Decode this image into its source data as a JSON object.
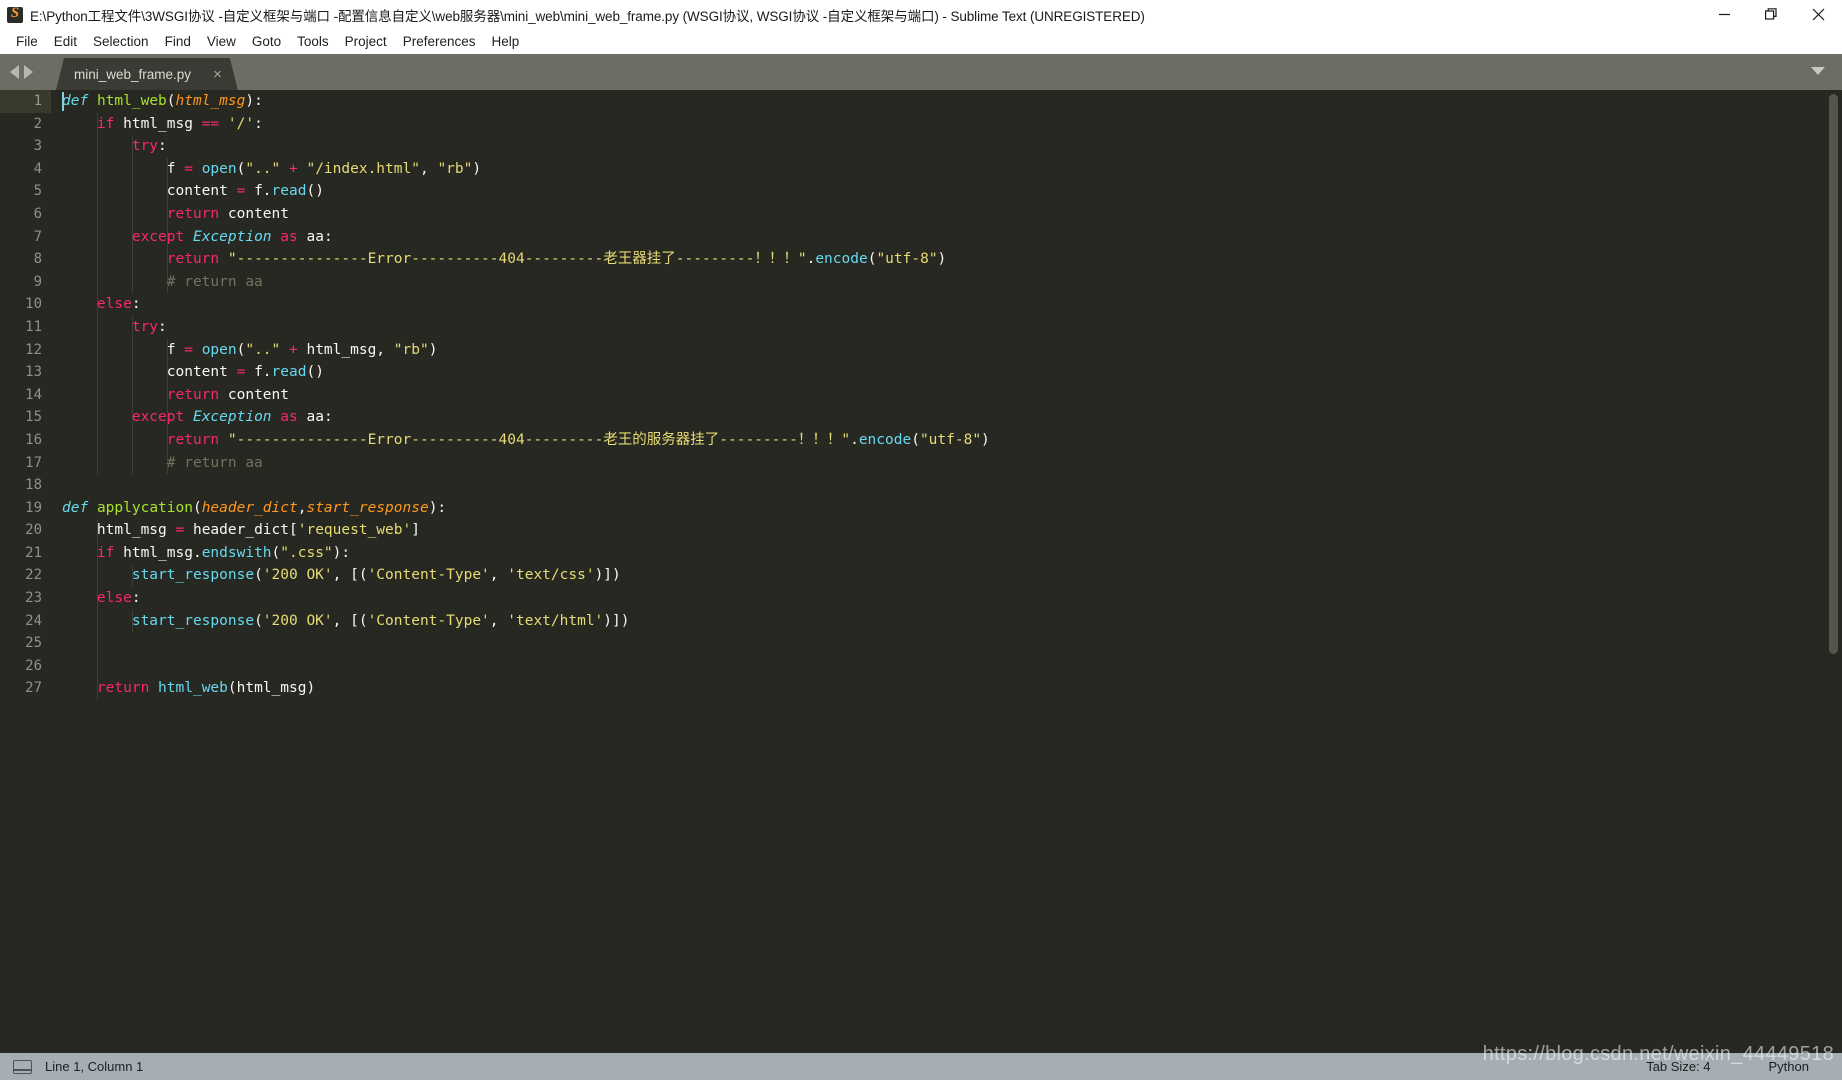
{
  "window": {
    "title": "E:\\Python工程文件\\3WSGI协议 -自定义框架与端口 -配置信息自定义\\web服务器\\mini_web\\mini_web_frame.py (WSGI协议, WSGI协议 -自定义框架与端口) - Sublime Text (UNREGISTERED)",
    "app_icon": "sublime-text-icon",
    "controls": {
      "minimize": "minimize-icon",
      "maximize": "maximize-icon",
      "close": "close-icon"
    }
  },
  "menu": {
    "items": [
      "File",
      "Edit",
      "Selection",
      "Find",
      "View",
      "Goto",
      "Tools",
      "Project",
      "Preferences",
      "Help"
    ]
  },
  "tabs": {
    "prev_icon": "arrow-left-icon",
    "next_icon": "arrow-right-icon",
    "overflow_icon": "chevron-down-icon",
    "open": [
      {
        "label": "mini_web_frame.py",
        "close": "×",
        "active": true
      }
    ]
  },
  "editor": {
    "caret_line": 1,
    "line_numbers": [
      "1",
      "2",
      "3",
      "4",
      "5",
      "6",
      "7",
      "8",
      "9",
      "10",
      "11",
      "12",
      "13",
      "14",
      "15",
      "16",
      "17",
      "18",
      "19",
      "20",
      "21",
      "22",
      "23",
      "24",
      "25",
      "26",
      "27"
    ],
    "lines": [
      {
        "n": 1,
        "tokens": [
          {
            "t": "def",
            "c": "kd"
          },
          {
            "t": " ",
            "c": "pl"
          },
          {
            "t": "html_web",
            "c": "fn"
          },
          {
            "t": "(",
            "c": "pl"
          },
          {
            "t": "html_msg",
            "c": "pa"
          },
          {
            "t": "):",
            "c": "pl"
          }
        ]
      },
      {
        "n": 2,
        "tokens": [
          {
            "t": "    ",
            "c": "pl"
          },
          {
            "t": "if",
            "c": "k"
          },
          {
            "t": " html_msg ",
            "c": "pl"
          },
          {
            "t": "==",
            "c": "op"
          },
          {
            "t": " ",
            "c": "pl"
          },
          {
            "t": "'/'",
            "c": "st"
          },
          {
            "t": ":",
            "c": "pl"
          }
        ]
      },
      {
        "n": 3,
        "tokens": [
          {
            "t": "        ",
            "c": "pl"
          },
          {
            "t": "try",
            "c": "k"
          },
          {
            "t": ":",
            "c": "pl"
          }
        ]
      },
      {
        "n": 4,
        "tokens": [
          {
            "t": "            f ",
            "c": "pl"
          },
          {
            "t": "=",
            "c": "op"
          },
          {
            "t": " ",
            "c": "pl"
          },
          {
            "t": "open",
            "c": "bi"
          },
          {
            "t": "(",
            "c": "pl"
          },
          {
            "t": "\"..\"",
            "c": "st"
          },
          {
            "t": " ",
            "c": "pl"
          },
          {
            "t": "+",
            "c": "op"
          },
          {
            "t": " ",
            "c": "pl"
          },
          {
            "t": "\"/index.html\"",
            "c": "st"
          },
          {
            "t": ", ",
            "c": "pl"
          },
          {
            "t": "\"rb\"",
            "c": "st"
          },
          {
            "t": ")",
            "c": "pl"
          }
        ]
      },
      {
        "n": 5,
        "tokens": [
          {
            "t": "            content ",
            "c": "pl"
          },
          {
            "t": "=",
            "c": "op"
          },
          {
            "t": " f.",
            "c": "pl"
          },
          {
            "t": "read",
            "c": "bi"
          },
          {
            "t": "()",
            "c": "pl"
          }
        ]
      },
      {
        "n": 6,
        "tokens": [
          {
            "t": "            ",
            "c": "pl"
          },
          {
            "t": "return",
            "c": "k"
          },
          {
            "t": " content",
            "c": "pl"
          }
        ]
      },
      {
        "n": 7,
        "tokens": [
          {
            "t": "        ",
            "c": "pl"
          },
          {
            "t": "except",
            "c": "k"
          },
          {
            "t": " ",
            "c": "pl"
          },
          {
            "t": "Exception",
            "c": "cls"
          },
          {
            "t": " ",
            "c": "pl"
          },
          {
            "t": "as",
            "c": "k"
          },
          {
            "t": " aa:",
            "c": "pl"
          }
        ]
      },
      {
        "n": 8,
        "tokens": [
          {
            "t": "            ",
            "c": "pl"
          },
          {
            "t": "return",
            "c": "k"
          },
          {
            "t": " ",
            "c": "pl"
          },
          {
            "t": "\"---------------Error----------404---------老王器挂了---------！！！\"",
            "c": "st"
          },
          {
            "t": ".",
            "c": "pl"
          },
          {
            "t": "encode",
            "c": "bi"
          },
          {
            "t": "(",
            "c": "pl"
          },
          {
            "t": "\"utf-8\"",
            "c": "st"
          },
          {
            "t": ")",
            "c": "pl"
          }
        ]
      },
      {
        "n": 9,
        "tokens": [
          {
            "t": "            # return aa",
            "c": "cm"
          }
        ]
      },
      {
        "n": 10,
        "tokens": [
          {
            "t": "    ",
            "c": "pl"
          },
          {
            "t": "else",
            "c": "k"
          },
          {
            "t": ":",
            "c": "pl"
          }
        ]
      },
      {
        "n": 11,
        "tokens": [
          {
            "t": "        ",
            "c": "pl"
          },
          {
            "t": "try",
            "c": "k"
          },
          {
            "t": ":",
            "c": "pl"
          }
        ]
      },
      {
        "n": 12,
        "tokens": [
          {
            "t": "            f ",
            "c": "pl"
          },
          {
            "t": "=",
            "c": "op"
          },
          {
            "t": " ",
            "c": "pl"
          },
          {
            "t": "open",
            "c": "bi"
          },
          {
            "t": "(",
            "c": "pl"
          },
          {
            "t": "\"..\"",
            "c": "st"
          },
          {
            "t": " ",
            "c": "pl"
          },
          {
            "t": "+",
            "c": "op"
          },
          {
            "t": " html_msg, ",
            "c": "pl"
          },
          {
            "t": "\"rb\"",
            "c": "st"
          },
          {
            "t": ")",
            "c": "pl"
          }
        ]
      },
      {
        "n": 13,
        "tokens": [
          {
            "t": "            content ",
            "c": "pl"
          },
          {
            "t": "=",
            "c": "op"
          },
          {
            "t": " f.",
            "c": "pl"
          },
          {
            "t": "read",
            "c": "bi"
          },
          {
            "t": "()",
            "c": "pl"
          }
        ]
      },
      {
        "n": 14,
        "tokens": [
          {
            "t": "            ",
            "c": "pl"
          },
          {
            "t": "return",
            "c": "k"
          },
          {
            "t": " content",
            "c": "pl"
          }
        ]
      },
      {
        "n": 15,
        "tokens": [
          {
            "t": "        ",
            "c": "pl"
          },
          {
            "t": "except",
            "c": "k"
          },
          {
            "t": " ",
            "c": "pl"
          },
          {
            "t": "Exception",
            "c": "cls"
          },
          {
            "t": " ",
            "c": "pl"
          },
          {
            "t": "as",
            "c": "k"
          },
          {
            "t": " aa:",
            "c": "pl"
          }
        ]
      },
      {
        "n": 16,
        "tokens": [
          {
            "t": "            ",
            "c": "pl"
          },
          {
            "t": "return",
            "c": "k"
          },
          {
            "t": " ",
            "c": "pl"
          },
          {
            "t": "\"---------------Error----------404---------老王的服务器挂了---------！！！\"",
            "c": "st"
          },
          {
            "t": ".",
            "c": "pl"
          },
          {
            "t": "encode",
            "c": "bi"
          },
          {
            "t": "(",
            "c": "pl"
          },
          {
            "t": "\"utf-8\"",
            "c": "st"
          },
          {
            "t": ")",
            "c": "pl"
          }
        ]
      },
      {
        "n": 17,
        "tokens": [
          {
            "t": "            # return aa",
            "c": "cm"
          }
        ]
      },
      {
        "n": 18,
        "tokens": []
      },
      {
        "n": 19,
        "tokens": [
          {
            "t": "def",
            "c": "kd"
          },
          {
            "t": " ",
            "c": "pl"
          },
          {
            "t": "applycation",
            "c": "fn"
          },
          {
            "t": "(",
            "c": "pl"
          },
          {
            "t": "header_dict",
            "c": "pa"
          },
          {
            "t": ",",
            "c": "pl"
          },
          {
            "t": "start_response",
            "c": "pa"
          },
          {
            "t": "):",
            "c": "pl"
          }
        ]
      },
      {
        "n": 20,
        "tokens": [
          {
            "t": "    html_msg ",
            "c": "pl"
          },
          {
            "t": "=",
            "c": "op"
          },
          {
            "t": " header_dict[",
            "c": "pl"
          },
          {
            "t": "'request_web'",
            "c": "st"
          },
          {
            "t": "]",
            "c": "pl"
          }
        ]
      },
      {
        "n": 21,
        "tokens": [
          {
            "t": "    ",
            "c": "pl"
          },
          {
            "t": "if",
            "c": "k"
          },
          {
            "t": " html_msg.",
            "c": "pl"
          },
          {
            "t": "endswith",
            "c": "bi"
          },
          {
            "t": "(",
            "c": "pl"
          },
          {
            "t": "\".css\"",
            "c": "st"
          },
          {
            "t": "):",
            "c": "pl"
          }
        ]
      },
      {
        "n": 22,
        "tokens": [
          {
            "t": "        ",
            "c": "pl"
          },
          {
            "t": "start_response",
            "c": "bi"
          },
          {
            "t": "(",
            "c": "pl"
          },
          {
            "t": "'200 OK'",
            "c": "st"
          },
          {
            "t": ", [(",
            "c": "pl"
          },
          {
            "t": "'Content-Type'",
            "c": "st"
          },
          {
            "t": ", ",
            "c": "pl"
          },
          {
            "t": "'text/css'",
            "c": "st"
          },
          {
            "t": ")])",
            "c": "pl"
          }
        ]
      },
      {
        "n": 23,
        "tokens": [
          {
            "t": "    ",
            "c": "pl"
          },
          {
            "t": "else",
            "c": "k"
          },
          {
            "t": ":",
            "c": "pl"
          }
        ]
      },
      {
        "n": 24,
        "tokens": [
          {
            "t": "        ",
            "c": "pl"
          },
          {
            "t": "start_response",
            "c": "bi"
          },
          {
            "t": "(",
            "c": "pl"
          },
          {
            "t": "'200 OK'",
            "c": "st"
          },
          {
            "t": ", [(",
            "c": "pl"
          },
          {
            "t": "'Content-Type'",
            "c": "st"
          },
          {
            "t": ", ",
            "c": "pl"
          },
          {
            "t": "'text/html'",
            "c": "st"
          },
          {
            "t": ")])",
            "c": "pl"
          }
        ]
      },
      {
        "n": 25,
        "tokens": []
      },
      {
        "n": 26,
        "tokens": []
      },
      {
        "n": 27,
        "tokens": [
          {
            "t": "    ",
            "c": "pl"
          },
          {
            "t": "return",
            "c": "k"
          },
          {
            "t": " ",
            "c": "pl"
          },
          {
            "t": "html_web",
            "c": "bi"
          },
          {
            "t": "(html_msg)",
            "c": "pl"
          }
        ]
      }
    ]
  },
  "statusbar": {
    "sidebar_icon": "panel-icon",
    "position": "Line 1, Column 1",
    "tab_size": "Tab Size: 4",
    "syntax": "Python"
  },
  "watermark": {
    "text": "https://blog.csdn.net/weixin_44449518"
  },
  "colors": {
    "editor_bg": "#272822",
    "tabstrip_bg": "#6d6d66",
    "active_tab_bg": "#3b3a34",
    "statusbar_bg": "#a6aeb4",
    "keyword": "#f92672",
    "string": "#e6db74",
    "function": "#a6e22e",
    "param": "#fd971f",
    "builtin": "#66d9ef",
    "comment": "#75715e"
  }
}
